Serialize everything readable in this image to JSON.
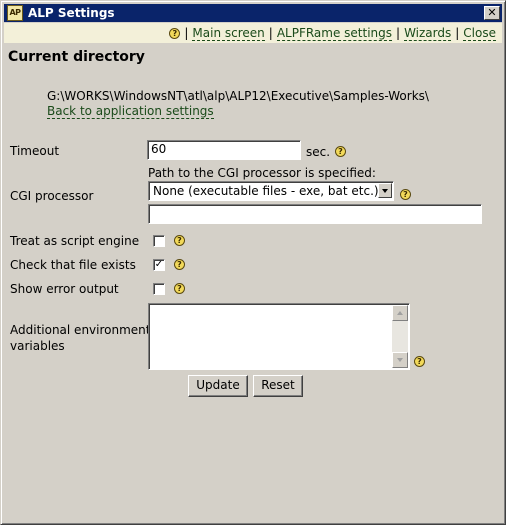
{
  "window": {
    "title": "ALP Settings",
    "logo_text": "AP",
    "close_symbol": "✕"
  },
  "menubar": {
    "help_icon": "help-icon",
    "items": [
      "Main screen",
      "ALPFRame settings",
      "Wizards",
      "Close"
    ],
    "separator": "|"
  },
  "page": {
    "heading": "Current directory",
    "directory": "G:\\WORKS\\WindowsNT\\atl\\alp\\ALP12\\Executive\\Samples-Works\\",
    "back_link": "Back to application settings"
  },
  "form": {
    "timeout": {
      "label": "Timeout",
      "value": "60",
      "unit": "sec."
    },
    "cgi": {
      "label": "CGI processor",
      "path_hint": "Path to the CGI processor is specified:",
      "selected": "None (executable files - exe, bat etc.)",
      "path_value": ""
    },
    "script_engine": {
      "label": "Treat as script engine",
      "checked": false
    },
    "check_file": {
      "label": "Check that file exists",
      "checked": true
    },
    "error_output": {
      "label": "Show error output",
      "checked": false
    },
    "env": {
      "label_line1": "Additional environment",
      "label_line2": "variables",
      "value": ""
    },
    "buttons": {
      "update": "Update",
      "reset": "Reset"
    },
    "check_mark": "✓",
    "help_glyph": "?"
  },
  "colors": {
    "titlebar": "#0a246a",
    "menubar_bg": "#f3f0d9",
    "link": "#1a4a1a",
    "window_bg": "#d4d0c8"
  }
}
